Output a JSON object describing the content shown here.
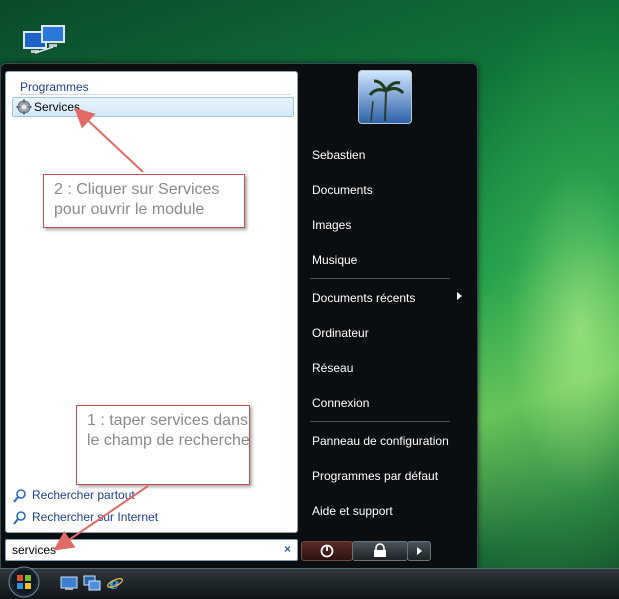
{
  "start_menu": {
    "programs_header": "Programmes",
    "result_item": {
      "label": "Services",
      "icon": "gear-icon"
    },
    "search_links": [
      {
        "label": "Rechercher partout",
        "icon": "search-icon"
      },
      {
        "label": "Rechercher sur Internet",
        "icon": "search-icon"
      }
    ],
    "search": {
      "value": "services",
      "clear_icon": "×"
    },
    "right_items": [
      "Sebastien",
      "Documents",
      "Images",
      "Musique",
      "Documents récents",
      "Ordinateur",
      "Réseau",
      "Connexion",
      "Panneau de configuration",
      "Programmes par défaut",
      "Aide et support"
    ],
    "buttons": {
      "power": "power-icon",
      "lock": "lock-icon",
      "more": "chevron-right-icon"
    }
  },
  "callouts": {
    "step2": "2 : Cliquer sur Services pour ouvrir le module",
    "step1": "1 : taper services dans le champ de recherche"
  },
  "colors": {
    "annotation": "#c0504d",
    "link": "#1e3f8e",
    "menu_dark": "#0b0e10"
  }
}
